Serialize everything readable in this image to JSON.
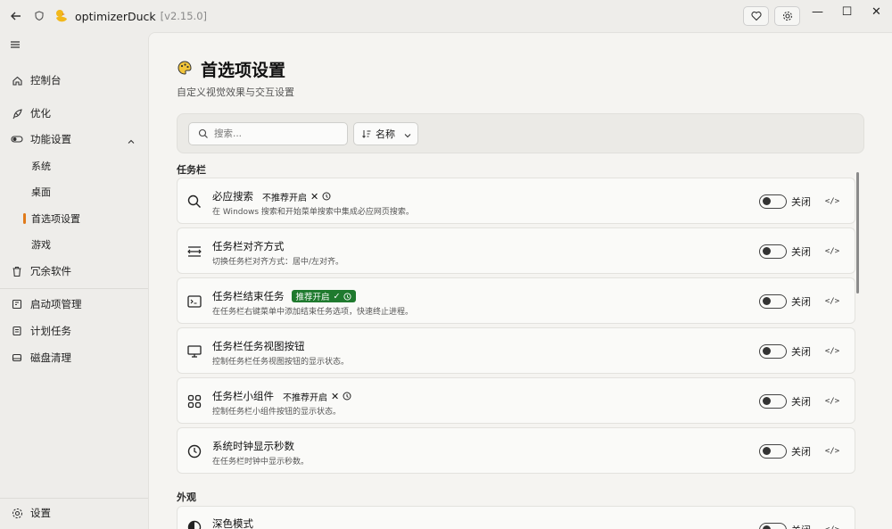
{
  "app": {
    "title": "optimizerDuck",
    "version": "[v2.15.0]"
  },
  "window_controls": {
    "minimize": "—",
    "maximize": "☐",
    "close": "✕"
  },
  "sidebar": {
    "items": [
      {
        "label": "控制台",
        "icon": "home-icon"
      },
      {
        "label": "优化",
        "icon": "rocket-icon"
      },
      {
        "label": "功能设置",
        "icon": "toggle-icon",
        "expanded": true,
        "children": [
          {
            "label": "系统",
            "active": false
          },
          {
            "label": "桌面",
            "active": false
          },
          {
            "label": "首选项设置",
            "active": true
          },
          {
            "label": "游戏",
            "active": false
          }
        ]
      },
      {
        "label": "冗余软件",
        "icon": "trash-icon"
      },
      {
        "label": "启动项管理",
        "icon": "startup-icon"
      },
      {
        "label": "计划任务",
        "icon": "tasks-icon"
      },
      {
        "label": "磁盘清理",
        "icon": "disk-icon"
      }
    ],
    "settings_label": "设置"
  },
  "page": {
    "title": "首选项设置",
    "subtitle": "自定义视觉效果与交互设置"
  },
  "toolbar": {
    "search_placeholder": "搜索...",
    "sort_label": "名称"
  },
  "sections": [
    {
      "label": "任务栏",
      "items": [
        {
          "title": "必应搜索",
          "tag": "不推荐开启",
          "tag_type": "warn",
          "desc": "在 Windows 搜索和开始菜单搜索中集成必应网页搜索。",
          "state": "关闭",
          "icon": "search-icon"
        },
        {
          "title": "任务栏对齐方式",
          "tag": "",
          "tag_type": "",
          "desc": "切换任务栏对齐方式：居中/左对齐。",
          "state": "关闭",
          "icon": "align-icon"
        },
        {
          "title": "任务栏结束任务",
          "tag": "推荐开启",
          "tag_type": "good",
          "desc": "在任务栏右键菜单中添加结束任务选项，快速终止进程。",
          "state": "关闭",
          "icon": "terminal-icon"
        },
        {
          "title": "任务栏任务视图按钮",
          "tag": "",
          "tag_type": "",
          "desc": "控制任务栏任务视图按钮的显示状态。",
          "state": "关闭",
          "icon": "monitor-icon"
        },
        {
          "title": "任务栏小组件",
          "tag": "不推荐开启",
          "tag_type": "warn",
          "desc": "控制任务栏小组件按钮的显示状态。",
          "state": "关闭",
          "icon": "widgets-icon"
        },
        {
          "title": "系统时钟显示秒数",
          "tag": "",
          "tag_type": "",
          "desc": "在任务栏时钟中显示秒数。",
          "state": "关闭",
          "icon": "clock-icon"
        }
      ]
    },
    {
      "label": "外观",
      "items": [
        {
          "title": "深色模式",
          "tag": "",
          "tag_type": "",
          "desc": "",
          "state": "关闭",
          "icon": "contrast-icon"
        }
      ]
    }
  ]
}
